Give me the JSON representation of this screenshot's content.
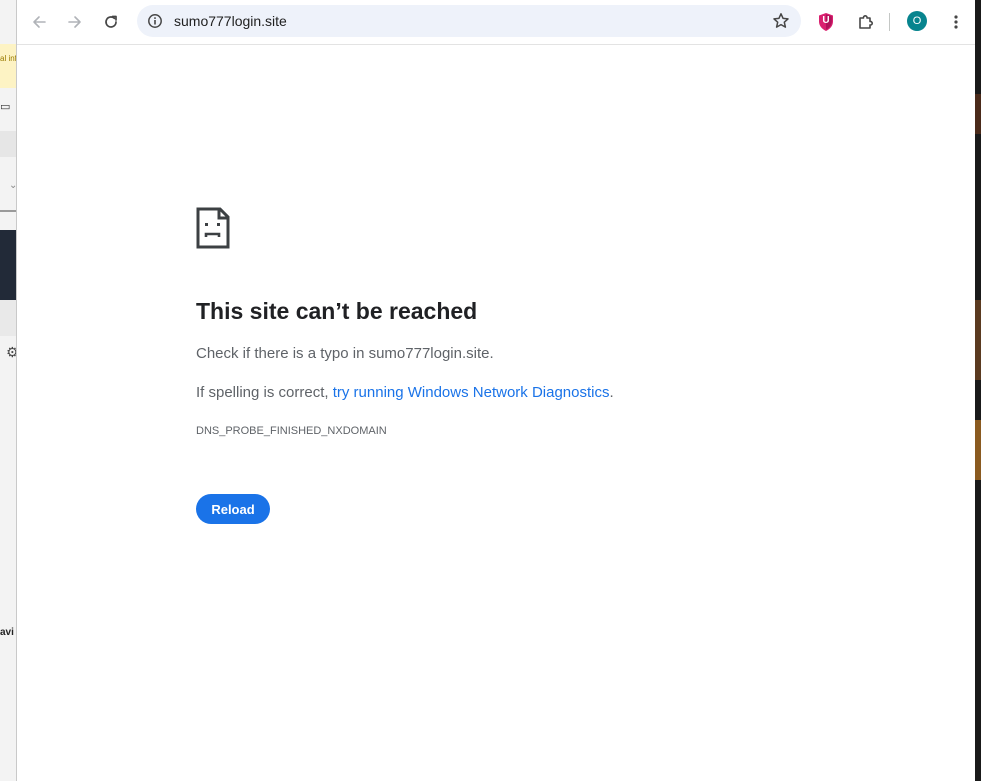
{
  "browser": {
    "url": "sumo777login.site",
    "profile_initial": "O",
    "ext_badge": "U"
  },
  "background_window": {
    "banner_fragment": "al inf",
    "text_fragment": "avi"
  },
  "error_page": {
    "title": "This site can’t be reached",
    "line1": "Check if there is a typo in sumo777login.site.",
    "line2_prefix": "If spelling is correct, ",
    "line2_link": "try running Windows Network Diagnostics",
    "line2_suffix": ".",
    "error_code": "DNS_PROBE_FINISHED_NXDOMAIN",
    "reload_label": "Reload"
  },
  "icons": {
    "back": "back-arrow-icon",
    "forward": "forward-arrow-icon",
    "reload": "reload-icon",
    "site_info": "info-icon",
    "bookmark": "star-icon",
    "extension": "shield-extension-icon",
    "extensions_menu": "puzzle-icon",
    "menu": "kebab-menu-icon",
    "error": "sad-page-icon"
  },
  "colors": {
    "accent": "#1a73e8",
    "omnibox_bg": "#eef2fa",
    "avatar_bg": "#07848e",
    "title": "#202124",
    "body_text": "#5f6368"
  }
}
